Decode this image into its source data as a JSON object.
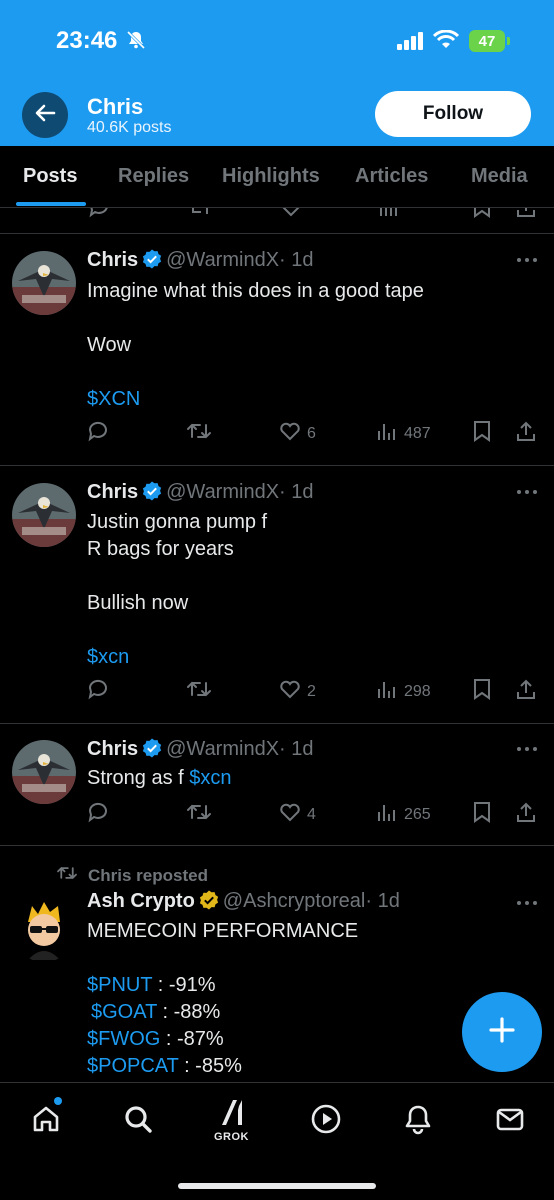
{
  "status_bar": {
    "time": "23:46",
    "battery": "47"
  },
  "header": {
    "name": "Chris",
    "posts_count": "40.6K posts",
    "follow_label": "Follow"
  },
  "tabs": [
    {
      "label": "Posts"
    },
    {
      "label": "Replies"
    },
    {
      "label": "Highlights"
    },
    {
      "label": "Articles"
    },
    {
      "label": "Media"
    }
  ],
  "posts": [
    {
      "name": "Chris",
      "handle": "@WarmindX",
      "time": "· 1d",
      "text": "Imagine what this does in a good tape\n\nWow",
      "cashtag": "$XCN",
      "likes": "6",
      "views": "487"
    },
    {
      "name": "Chris",
      "handle": "@WarmindX",
      "time": "· 1d",
      "text": "Justin gonna pump f\nR bags for years\n\nBullish now",
      "cashtag": "$xcn",
      "likes": "2",
      "views": "298"
    },
    {
      "name": "Chris",
      "handle": "@WarmindX",
      "time": "· 1d",
      "text": "Strong as f ",
      "cashtag": "$xcn",
      "likes": "4",
      "views": "265"
    }
  ],
  "repost": {
    "label": "Chris reposted",
    "name": "Ash Crypto",
    "handle": "@Ashcryptoreal",
    "time": "· 1d",
    "headline": "MEMECOIN PERFORMANCE",
    "rows": [
      {
        "tag": "$PNUT",
        "value": " : -91%"
      },
      {
        "tag": "$GOAT",
        "value": " : -88%"
      },
      {
        "tag": "$FWOG",
        "value": " : -87%"
      },
      {
        "tag": "$POPCAT",
        "value": " : -85%"
      }
    ]
  },
  "bottom_nav": {
    "grok_label": "GROK"
  },
  "colors": {
    "accent": "#1d9bf0",
    "banner": "#1d9bf0",
    "background": "#000000",
    "muted": "#71767b",
    "gold_badge": "#e2b719"
  },
  "icons": [
    "back-arrow-icon",
    "bell-slash-icon",
    "signal-icon",
    "wifi-icon",
    "verified-badge-icon",
    "more-icon",
    "reply-icon",
    "repost-icon",
    "like-icon",
    "views-icon",
    "bookmark-icon",
    "share-icon",
    "home-icon",
    "search-icon",
    "grok-icon",
    "video-icon",
    "notifications-icon",
    "messages-icon",
    "compose-icon"
  ]
}
